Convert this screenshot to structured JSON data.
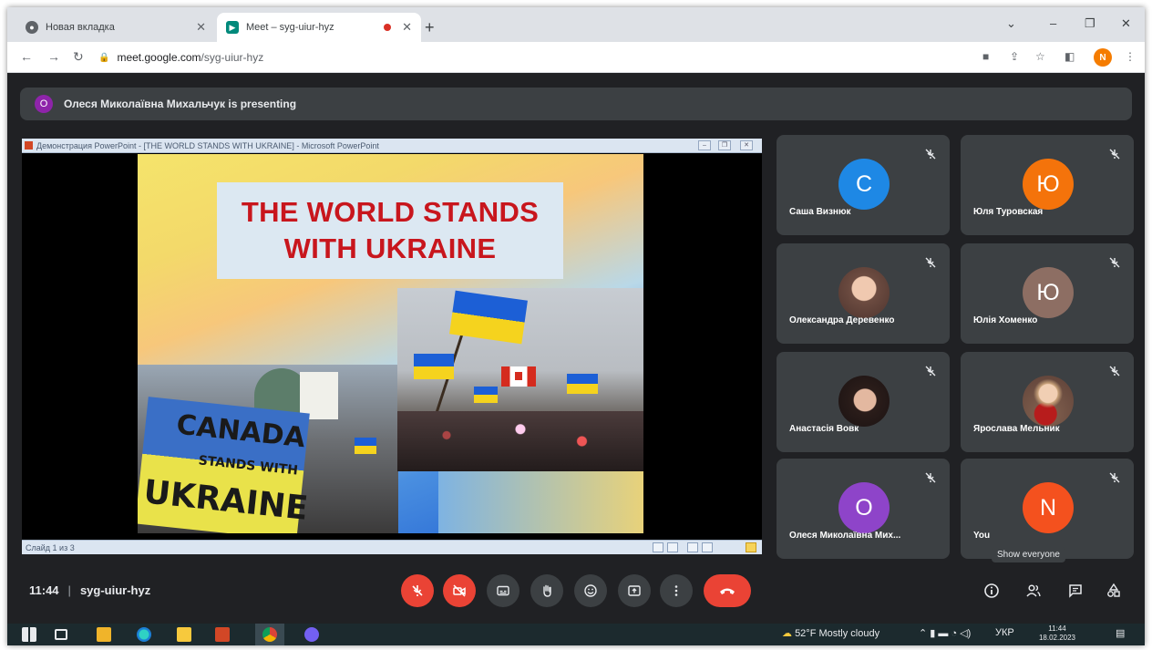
{
  "browser": {
    "tabs": [
      {
        "title": "Новая вкладка",
        "active": false
      },
      {
        "title": "Meet – syg-uiur-hyz",
        "active": true
      }
    ],
    "url_host": "meet.google.com",
    "url_path": "/syg-uiur-hyz",
    "profile_initial": "N"
  },
  "banner": {
    "avatar_letter": "О",
    "text": "Олеся Миколаївна Михальчук is presenting"
  },
  "presentation": {
    "window_title": "Демонстрация PowerPoint - [THE WORLD STANDS WITH UKRAINE] - Microsoft PowerPoint",
    "slide_title_line1": "THE WORLD STANDS",
    "slide_title_line2": "WITH UKRAINE",
    "sign_line1": "CANADA",
    "sign_line2": "STANDS WITH",
    "sign_line3": "UKRAINE",
    "status_text": "Слайд 1 из 3"
  },
  "participants": [
    {
      "name": "Саша Визнюк",
      "letter": "С",
      "color": "#1e88e5",
      "type": "letter"
    },
    {
      "name": "Юля Туровская",
      "letter": "Ю",
      "color": "#f4730b",
      "type": "letter"
    },
    {
      "name": "Олександра Деревенко",
      "letter": "",
      "color": "#6d4c41",
      "type": "photo"
    },
    {
      "name": "Юлія Хоменко",
      "letter": "Ю",
      "color": "#8d6e63",
      "type": "letter"
    },
    {
      "name": "Анастасія Вовк",
      "letter": "",
      "color": "#3e2723",
      "type": "photo"
    },
    {
      "name": "Ярослава Мельник",
      "letter": "",
      "color": "#a1887f",
      "type": "photo"
    },
    {
      "name": "Олеся Миколаївна Мих...",
      "letter": "О",
      "color": "#8e44c9",
      "type": "letter"
    },
    {
      "name": "You",
      "letter": "N",
      "color": "#f4511e",
      "type": "letter"
    }
  ],
  "controls": {
    "time": "11:44",
    "meeting_code": "syg-uiur-hyz",
    "tooltip": "Show everyone"
  },
  "taskbar": {
    "weather": "52°F  Mostly cloudy",
    "lang": "УКР",
    "time": "11:44",
    "date": "18.02.2023"
  },
  "colors": {
    "meet_bg": "#202124",
    "tile_bg": "#3c4043",
    "danger": "#ea4335"
  }
}
